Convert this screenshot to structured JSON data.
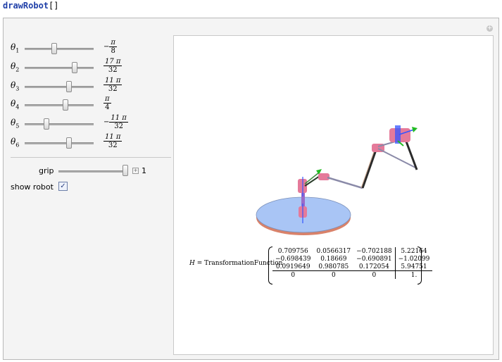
{
  "input": {
    "function": "drawRobot",
    "args": "[]"
  },
  "sliders": [
    {
      "label_sub": "1",
      "neg": "−",
      "num": "π",
      "den": "8",
      "fraction": 0.42
    },
    {
      "label_sub": "2",
      "neg": "",
      "num": "17 π",
      "den": "32",
      "fraction": 0.74
    },
    {
      "label_sub": "3",
      "neg": "",
      "num": "11 π",
      "den": "32",
      "fraction": 0.66
    },
    {
      "label_sub": "4",
      "neg": "",
      "num": "π",
      "den": "4",
      "fraction": 0.6
    },
    {
      "label_sub": "5",
      "neg": "−",
      "num": "11 π",
      "den": "32",
      "fraction": 0.3
    },
    {
      "label_sub": "6",
      "neg": "",
      "num": "11 π",
      "den": "32",
      "fraction": 0.66
    }
  ],
  "theta_symbol": "θ",
  "grip": {
    "label": "grip",
    "value": "1",
    "fraction": 1.0
  },
  "show_robot": {
    "label": "show robot",
    "checked": "✓"
  },
  "matrix": {
    "label_var": "H",
    "label_eq": " = TransformationFunction",
    "rows": [
      [
        "0.709756",
        "0.0566317",
        "−0.702188",
        "5.22164"
      ],
      [
        "−0.698439",
        "0.18669",
        "−0.690891",
        "−1.02099"
      ],
      [
        "0.0919649",
        "0.980785",
        "0.172054",
        "5.94751"
      ],
      [
        "0",
        "0",
        "0",
        "1."
      ]
    ]
  },
  "colors": {
    "disk": "#a9c5f5",
    "disk_edge": "#d9826a",
    "joint": "#e57a9a",
    "link": "#8a8aa8",
    "axis_blue": "#3355ff",
    "axis_green": "#22bb22"
  }
}
